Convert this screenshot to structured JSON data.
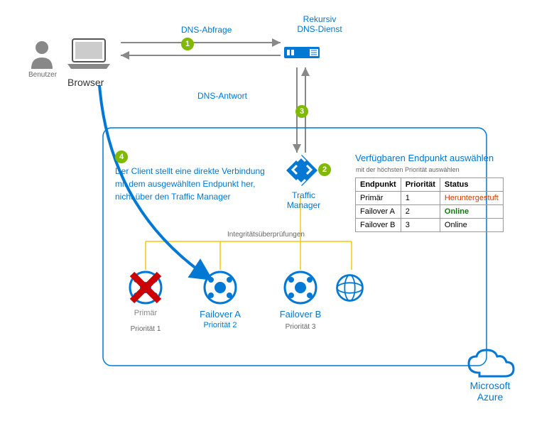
{
  "labels": {
    "user": "Benutzer",
    "browser": "Browser",
    "dns_query": "DNS-Abfrage",
    "dns_service_line1": "Rekursiv",
    "dns_service_line2": "DNS-Dienst",
    "dns_response": "DNS-Antwort",
    "select_endpoint_title": "Verfügbaren Endpunkt auswählen",
    "select_endpoint_sub": "mit der höchsten Priorität auswählen",
    "traffic_manager": "Traffic Manager",
    "health_checks": "Integritätsüberprüfungen",
    "client_connect_1": "Der Client stellt eine direkte Verbindung",
    "client_connect_2": "mit dem ausgewählten Endpunkt her,",
    "client_connect_3": "nicht über den Traffic Manager",
    "azure_line1": "Microsoft",
    "azure_line2": "Azure"
  },
  "badges": {
    "b1": "1",
    "b2": "2",
    "b3": "3",
    "b4": "4"
  },
  "table": {
    "headers": {
      "endpoint": "Endpunkt",
      "priority": "Priorität",
      "status": "Status"
    },
    "rows": [
      {
        "endpoint": "Primär",
        "priority": "1",
        "status": "Heruntergestuft",
        "status_class": "status-degraded"
      },
      {
        "endpoint": "Failover A",
        "priority": "2",
        "status": "Online",
        "status_class": "status-online"
      },
      {
        "endpoint": "Failover B",
        "priority": "3",
        "status": "Online",
        "status_class": ""
      }
    ]
  },
  "endpoints": {
    "primary": {
      "name": "Primär",
      "priority": "Priorität 1"
    },
    "failoverA": {
      "name": "Failover A",
      "priority": "Priorität 2"
    },
    "failoverB": {
      "name": "Failover B",
      "priority": "Priorität 3"
    }
  }
}
